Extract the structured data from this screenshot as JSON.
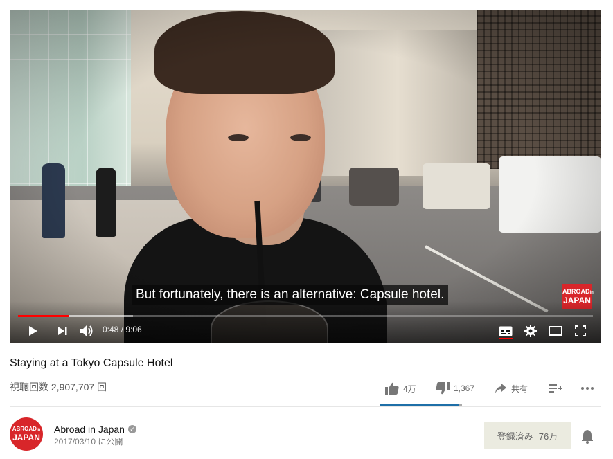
{
  "player": {
    "caption": "But fortunately, there is an alternative: Capsule hotel.",
    "watermark_top": "ABROAD",
    "watermark_small": "in",
    "watermark_bottom": "JAPAN",
    "current_time": "0:48",
    "duration": "9:06",
    "time_display": "0:48 / 9:06",
    "progress_fraction": 0.088,
    "buffered_fraction": 0.2,
    "accent_color": "#ff0000",
    "icons": [
      "play-icon",
      "next-icon",
      "volume-icon",
      "captions-icon",
      "settings-icon",
      "theater-icon",
      "fullscreen-icon"
    ]
  },
  "video": {
    "title": "Staying at a Tokyo Capsule Hotel",
    "views": "視聴回数 2,907,707 回",
    "likes": "4万",
    "dislikes": "1,367",
    "share_label": "共有",
    "like_fraction": 0.967,
    "sentiment_color": "#1e6fa8"
  },
  "channel": {
    "name": "Abroad in Japan",
    "published": "2017/03/10 に公開",
    "avatar_top": "ABROAD",
    "avatar_small": "in",
    "avatar_bottom": "JAPAN",
    "subscribed_label": "登録済み",
    "subscriber_count": "76万",
    "brand_color": "#d8262a"
  }
}
